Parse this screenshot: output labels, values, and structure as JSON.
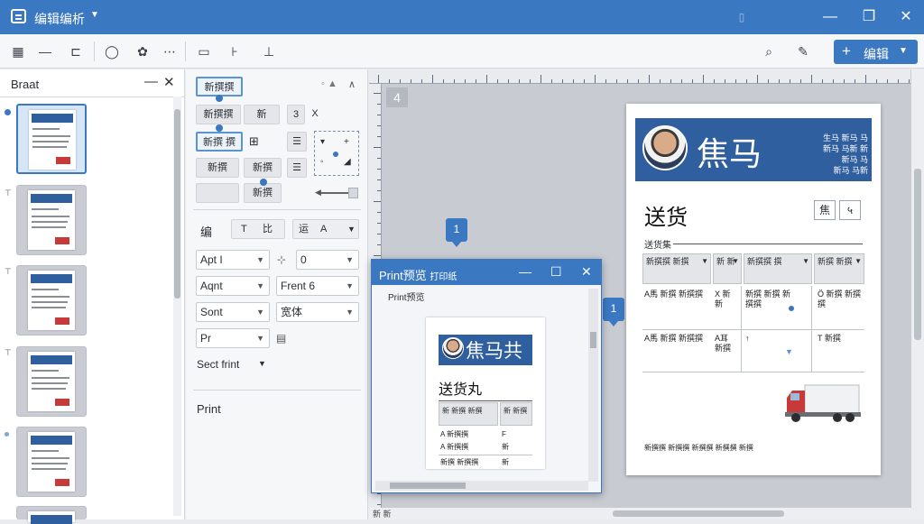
{
  "titlebar": {
    "title": "编辑编析",
    "minimize": "—",
    "restore": "❐",
    "close": "✕",
    "extra": "▯"
  },
  "toolbar": {
    "edit_label": "编辑"
  },
  "left_panel": {
    "title": "Braat",
    "collapse": "—",
    "close": "✕"
  },
  "format_panel": {
    "row1": "新撰撰",
    "row2": [
      "新撰撰",
      "新",
      "3",
      "X"
    ],
    "row3": "新撰 撰",
    "row4": [
      "新撰",
      "新撰"
    ],
    "row5": "新撰",
    "style_row": [
      "编",
      "T",
      "比",
      "运",
      "A"
    ],
    "dropdowns": [
      {
        "value": "Apt I",
        "has_arrow": true
      },
      {
        "value": "0",
        "has_arrow": true
      },
      {
        "value": "Aqnt",
        "has_arrow": true
      },
      {
        "value": "Frent 6",
        "has_arrow": true
      },
      {
        "value": "Sont",
        "has_arrow": true
      },
      {
        "value": "宽体",
        "has_arrow": true
      },
      {
        "value": "Pr",
        "has_arrow": true
      }
    ],
    "sect_label": "Sect frint",
    "print_label": "Print",
    "tooltip_icon": "◦ ▲"
  },
  "canvas": {
    "page_marker": "4",
    "badge1": "1",
    "badge2": "1"
  },
  "document": {
    "name": "焦马",
    "info_lines": [
      "生马 新马 马",
      "新马 马新 新",
      "新马 马",
      "新马 马新"
    ],
    "title": "送货",
    "subtitle": "送货集",
    "table_headers": [
      "新撰撰 新撰",
      "新 新",
      "新撰撰 撰",
      "新撰 新撰"
    ],
    "row1": [
      "A馬 新撰 新撰撰",
      "X 新 新",
      "新撰 新撰 新撰撰",
      "Ö 新撰 新撰撰"
    ],
    "row2": [
      "A馬 新撰 新撰撰",
      "A耳 新撰",
      "↑",
      "T 新撰"
    ],
    "footer": "新撰撰 新撰撰 新撰撰 新撰撰 新撰"
  },
  "print_dialog": {
    "title": "Print预览",
    "title_extra": "打印纸",
    "label": "Print预览",
    "preview_name": "焦马共",
    "preview_title": "送货丸",
    "preview_rows": [
      [
        "新 新撰 新撰",
        "新 新撰"
      ],
      [
        "A 新撰撰",
        "F"
      ],
      [
        "A 新撰撰",
        "新"
      ],
      [
        "新撰 新撰撰",
        "新"
      ]
    ]
  },
  "statusbar": {
    "left": "新 新"
  },
  "colors": {
    "accent": "#3b78c2",
    "header_blue": "#2f5f9e",
    "truck_red": "#c63a3a"
  }
}
